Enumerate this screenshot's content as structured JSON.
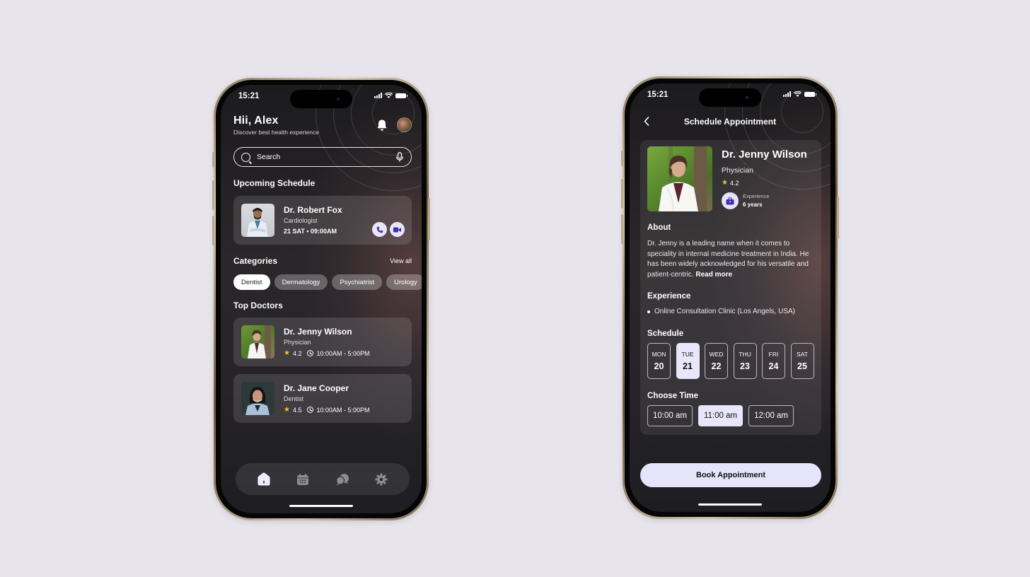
{
  "status_bar": {
    "time": "15:21"
  },
  "home_screen": {
    "greeting": "Hii, Alex",
    "subtitle": "Discover best health experience",
    "search": {
      "placeholder": "Search"
    },
    "upcoming": {
      "title": "Upcoming Schedule",
      "doctor": {
        "name": "Dr. Robert Fox",
        "specialty": "Cardiologist",
        "datetime": "21 SAT • 09:00AM"
      }
    },
    "categories": {
      "title": "Categories",
      "view_all": "View all",
      "items": [
        {
          "label": "Dentist",
          "active": true
        },
        {
          "label": "Dermatology",
          "active": false
        },
        {
          "label": "Psychiatrist",
          "active": false
        },
        {
          "label": "Urology",
          "active": false
        }
      ]
    },
    "top_doctors": {
      "title": "Top Doctors",
      "items": [
        {
          "name": "Dr. Jenny Wilson",
          "specialty": "Physician",
          "rating": "4.2",
          "hours": "10:00AM - 5:00PM"
        },
        {
          "name": "Dr. Jane Cooper",
          "specialty": "Dentist",
          "rating": "4.5",
          "hours": "10:00AM - 5:00PM"
        }
      ]
    },
    "tabbar": [
      {
        "icon": "home-icon",
        "active": true
      },
      {
        "icon": "calendar-icon",
        "active": false
      },
      {
        "icon": "chat-icon",
        "active": false
      },
      {
        "icon": "settings-icon",
        "active": false
      }
    ]
  },
  "schedule_screen": {
    "title": "Schedule Appointment",
    "doctor": {
      "name": "Dr. Jenny Wilson",
      "specialty": "Physician",
      "rating": "4.2",
      "experience_label": "Experience",
      "experience_value": "6 years"
    },
    "about": {
      "title": "About",
      "text": "Dr. Jenny is a leading name when it comes to speciality in internal medicine treatment in India. He has been widely acknowledged for his versatile and patient-centric.",
      "read_more": "Read more"
    },
    "experience": {
      "title": "Experience",
      "items": [
        "Online Consultation Clinic (Los Angels, USA)"
      ]
    },
    "schedule": {
      "title": "Schedule",
      "days": [
        {
          "day": "MON",
          "date": "20",
          "active": false
        },
        {
          "day": "TUE",
          "date": "21",
          "active": true
        },
        {
          "day": "WED",
          "date": "22",
          "active": false
        },
        {
          "day": "THU",
          "date": "23",
          "active": false
        },
        {
          "day": "FRI",
          "date": "24",
          "active": false
        },
        {
          "day": "SAT",
          "date": "25",
          "active": false
        }
      ]
    },
    "time": {
      "title": "Choose Time",
      "slots": [
        {
          "label": "10:00 am",
          "active": false
        },
        {
          "label": "11:00 am",
          "active": true
        },
        {
          "label": "12:00 am",
          "active": false
        }
      ]
    },
    "book_button": "Book Appointment"
  },
  "colors": {
    "background": "#e8e4ec",
    "accent_light": "#e8e6fb",
    "icon_accent": "#3f2fb0",
    "star": "#f5c12c"
  }
}
